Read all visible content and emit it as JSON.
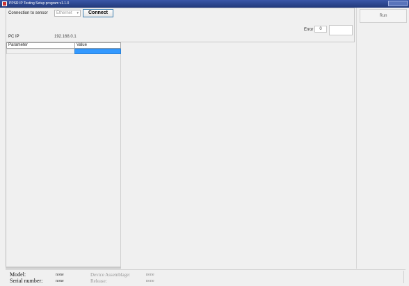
{
  "window": {
    "title": "PPSR IP Testing Setup program v1.1.0"
  },
  "connection": {
    "label": "Connection to sensor",
    "selected": "Ethernet",
    "connect_label": "Connect"
  },
  "pc_ip": {
    "label": "PC IP",
    "value": "192.168.0.1"
  },
  "error": {
    "label": "Error",
    "code": "0",
    "text": ""
  },
  "run_label": "Run",
  "grid": {
    "columns": [
      "Parameter",
      "Value"
    ],
    "rows": [
      {
        "parameter": "",
        "value": ""
      }
    ]
  },
  "status": {
    "model_label": "Model:",
    "model_value": "none",
    "serial_label": "Serial number:",
    "serial_value": "none",
    "assemblage_label": "Device Assemblage:",
    "assemblage_value": "none",
    "release_label": "Release:",
    "release_value": "none"
  }
}
